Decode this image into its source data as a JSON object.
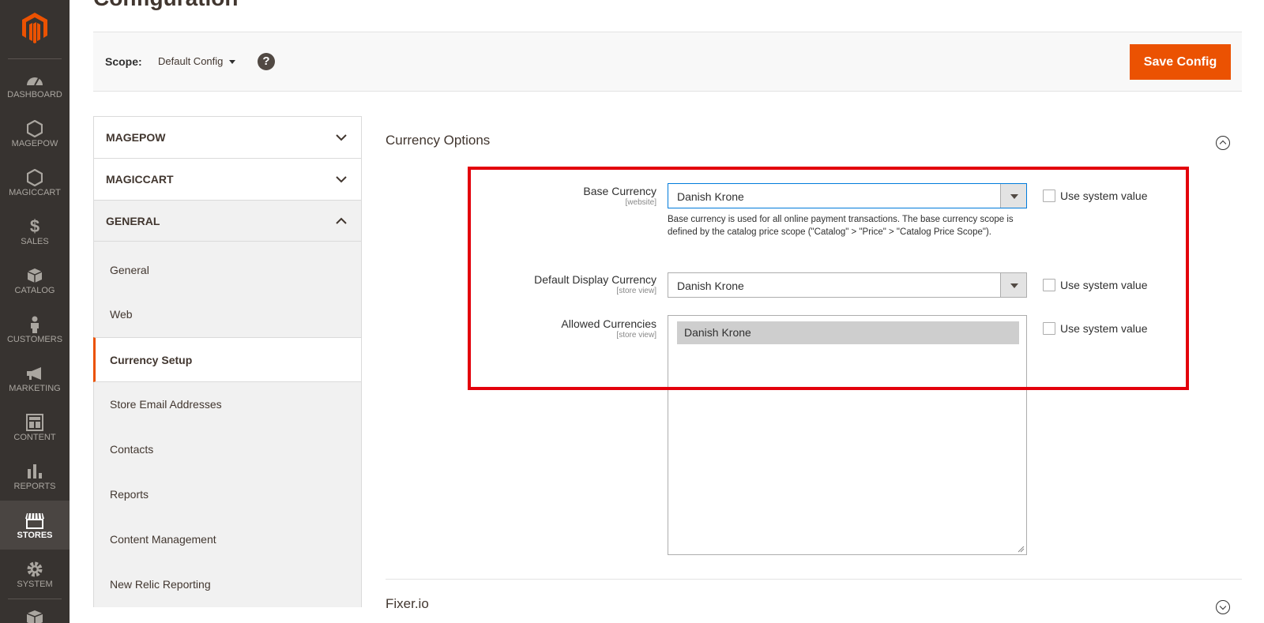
{
  "page": {
    "title": "Configuration"
  },
  "nav": {
    "items": [
      {
        "label": "DASHBOARD",
        "icon": "dashboard-icon"
      },
      {
        "label": "MAGEPOW",
        "icon": "hexagon-icon"
      },
      {
        "label": "MAGICCART",
        "icon": "hexagon-icon"
      },
      {
        "label": "SALES",
        "icon": "dollar-icon"
      },
      {
        "label": "CATALOG",
        "icon": "box-icon"
      },
      {
        "label": "CUSTOMERS",
        "icon": "person-icon"
      },
      {
        "label": "MARKETING",
        "icon": "megaphone-icon"
      },
      {
        "label": "CONTENT",
        "icon": "layout-icon"
      },
      {
        "label": "REPORTS",
        "icon": "bar-chart-icon"
      },
      {
        "label": "STORES",
        "icon": "store-icon"
      },
      {
        "label": "SYSTEM",
        "icon": "gear-icon"
      }
    ],
    "active": "STORES",
    "brand_color": "#eb5202"
  },
  "scope": {
    "label": "Scope:",
    "value": "Default Config",
    "help_glyph": "?"
  },
  "toolbar": {
    "save_label": "Save Config"
  },
  "tabs": {
    "groups": [
      {
        "title": "MAGEPOW"
      },
      {
        "title": "MAGICCART"
      },
      {
        "title": "GENERAL"
      }
    ],
    "general_items": [
      "General",
      "Web",
      "Currency Setup",
      "Store Email Addresses",
      "Contacts",
      "Reports",
      "Content Management",
      "New Relic Reporting"
    ],
    "active_item": "Currency Setup"
  },
  "section": {
    "title": "Currency Options",
    "fields": {
      "base_currency": {
        "label": "Base Currency",
        "scope": "[website]",
        "value": "Danish Krone",
        "note": "Base currency is used for all online payment transactions. The base currency scope is defined by the catalog price scope (\"Catalog\" > \"Price\" > \"Catalog Price Scope\").",
        "system_value_label": "Use system value"
      },
      "default_display_currency": {
        "label": "Default Display Currency",
        "scope": "[store view]",
        "value": "Danish Krone",
        "system_value_label": "Use system value"
      },
      "allowed_currencies": {
        "label": "Allowed Currencies",
        "scope": "[store view]",
        "selected_option": "Danish Krone",
        "system_value_label": "Use system value"
      }
    },
    "highlight_color": "#e3000b"
  },
  "section2": {
    "title": "Fixer.io"
  }
}
